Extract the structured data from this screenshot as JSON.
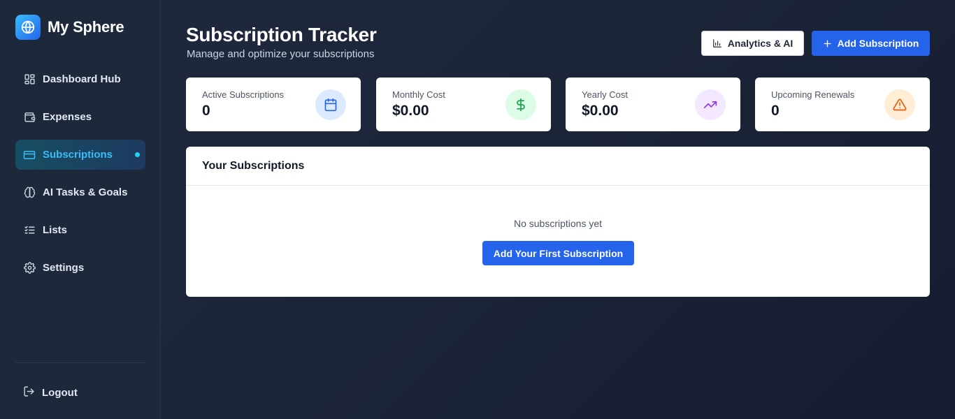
{
  "brand": {
    "name": "My Sphere",
    "icon": "globe-icon"
  },
  "sidebar": {
    "items": [
      {
        "label": "Dashboard Hub",
        "icon": "grid-icon",
        "active": false
      },
      {
        "label": "Expenses",
        "icon": "wallet-icon",
        "active": false
      },
      {
        "label": "Subscriptions",
        "icon": "credit-card-icon",
        "active": true
      },
      {
        "label": "AI Tasks & Goals",
        "icon": "brain-icon",
        "active": false
      },
      {
        "label": "Lists",
        "icon": "list-checks-icon",
        "active": false
      },
      {
        "label": "Settings",
        "icon": "gear-icon",
        "active": false
      }
    ],
    "logout_label": "Logout"
  },
  "header": {
    "title": "Subscription Tracker",
    "subtitle": "Manage and optimize your subscriptions",
    "analytics_label": "Analytics & AI",
    "add_label": "Add Subscription"
  },
  "stats": [
    {
      "label": "Active Subscriptions",
      "value": "0",
      "icon": "calendar-icon",
      "color": "#2563eb",
      "bg": "#dbeafe"
    },
    {
      "label": "Monthly Cost",
      "value": "$0.00",
      "icon": "dollar-icon",
      "color": "#16a34a",
      "bg": "#dcfce7"
    },
    {
      "label": "Yearly Cost",
      "value": "$0.00",
      "icon": "trending-up-icon",
      "color": "#9333ea",
      "bg": "#f3e8ff"
    },
    {
      "label": "Upcoming Renewals",
      "value": "0",
      "icon": "alert-triangle-icon",
      "color": "#ea580c",
      "bg": "#ffedd5"
    }
  ],
  "panel": {
    "title": "Your Subscriptions",
    "empty_text": "No subscriptions yet",
    "cta_label": "Add Your First Subscription"
  },
  "colors": {
    "accent": "#2563eb",
    "active_nav": "#38bdf8",
    "sidebar_bg": "#1e283b"
  }
}
